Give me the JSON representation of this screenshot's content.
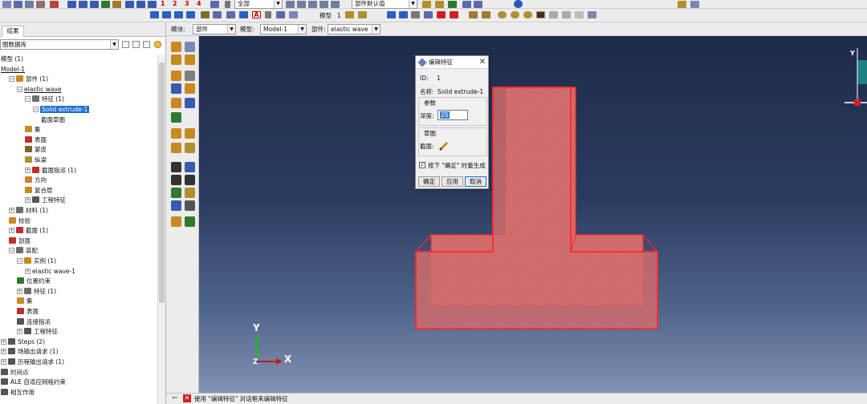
{
  "toolbar": {
    "numbers": [
      "1",
      "2",
      "3",
      "4"
    ],
    "render_style_value": "全部",
    "part_default_value": "部件默认值",
    "row2_label": "模型",
    "row2_value": "1"
  },
  "context_bar": {
    "module_label": "模块:",
    "module_value": "部件",
    "model_label": "模型:",
    "model_value": "Model-1",
    "part_label": "部件:",
    "part_value": "elastic wave"
  },
  "left_panel": {
    "tab_label": "结果",
    "db_value": "图数据库"
  },
  "tree": [
    {
      "label": "模型 (1)",
      "indent": 0,
      "expander": "",
      "icon": "",
      "selected": false,
      "underline": false
    },
    {
      "label": "Model-1",
      "indent": 0,
      "expander": "",
      "icon": "",
      "selected": false,
      "underline": true
    },
    {
      "label": "部件 (1)",
      "indent": 1,
      "expander": "−",
      "icon": "parts-icon",
      "selected": false,
      "underline": false
    },
    {
      "label": "elastic wave",
      "indent": 2,
      "expander": "−",
      "icon": "",
      "selected": false,
      "underline": true
    },
    {
      "label": "特征 (1)",
      "indent": 3,
      "expander": "−",
      "icon": "features-icon",
      "selected": false,
      "underline": false
    },
    {
      "label": "Solid extrude-1",
      "indent": 4,
      "expander": "−",
      "icon": "",
      "selected": true,
      "underline": false
    },
    {
      "label": "截面草图",
      "indent": 5,
      "expander": "",
      "icon": "",
      "selected": false,
      "underline": false
    },
    {
      "label": "集",
      "indent": 3,
      "expander": "",
      "icon": "sets-icon",
      "selected": false,
      "underline": false
    },
    {
      "label": "表面",
      "indent": 3,
      "expander": "",
      "icon": "surfaces-icon",
      "selected": false,
      "underline": false
    },
    {
      "label": "蒙皮",
      "indent": 3,
      "expander": "",
      "icon": "skins-icon",
      "selected": false,
      "underline": false
    },
    {
      "label": "纵梁",
      "indent": 3,
      "expander": "",
      "icon": "stringers-icon",
      "selected": false,
      "underline": false
    },
    {
      "label": "截面指派 (1)",
      "indent": 3,
      "expander": "+",
      "icon": "section-assignments-icon",
      "selected": false,
      "underline": false
    },
    {
      "label": "方向",
      "indent": 3,
      "expander": "",
      "icon": "orientations-icon",
      "selected": false,
      "underline": false
    },
    {
      "label": "复合层",
      "indent": 3,
      "expander": "",
      "icon": "composite-layups-icon",
      "selected": false,
      "underline": false
    },
    {
      "label": "工程特征",
      "indent": 3,
      "expander": "+",
      "icon": "engineering-features-icon",
      "selected": false,
      "underline": false
    },
    {
      "label": "材料 (1)",
      "indent": 1,
      "expander": "+",
      "icon": "materials-icon",
      "selected": false,
      "underline": false
    },
    {
      "label": "校验",
      "indent": 1,
      "expander": "",
      "icon": "calibrations-icon",
      "selected": false,
      "underline": false
    },
    {
      "label": "截面 (1)",
      "indent": 1,
      "expander": "+",
      "icon": "sections-icon",
      "selected": false,
      "underline": false
    },
    {
      "label": "剖面",
      "indent": 1,
      "expander": "",
      "icon": "profiles-icon",
      "selected": false,
      "underline": false
    },
    {
      "label": "装配",
      "indent": 1,
      "expander": "−",
      "icon": "assembly-icon",
      "selected": false,
      "underline": false
    },
    {
      "label": "实例 (1)",
      "indent": 2,
      "expander": "−",
      "icon": "instances-icon",
      "selected": false,
      "underline": false
    },
    {
      "label": "elastic wave-1",
      "indent": 3,
      "expander": "+",
      "icon": "",
      "selected": false,
      "underline": false
    },
    {
      "label": "位置约束",
      "indent": 2,
      "expander": "",
      "icon": "position-constraints-icon",
      "selected": false,
      "underline": false
    },
    {
      "label": "特征 (1)",
      "indent": 2,
      "expander": "+",
      "icon": "features-icon",
      "selected": false,
      "underline": false
    },
    {
      "label": "集",
      "indent": 2,
      "expander": "",
      "icon": "sets-icon",
      "selected": false,
      "underline": false
    },
    {
      "label": "表面",
      "indent": 2,
      "expander": "",
      "icon": "surfaces-icon",
      "selected": false,
      "underline": false
    },
    {
      "label": "连接指派",
      "indent": 2,
      "expander": "",
      "icon": "connector-assignments-icon",
      "selected": false,
      "underline": false
    },
    {
      "label": "工程特征",
      "indent": 2,
      "expander": "+",
      "icon": "engineering-features-icon",
      "selected": false,
      "underline": false
    },
    {
      "label": "Steps (2)",
      "indent": 0,
      "expander": "+",
      "icon": "steps-icon",
      "selected": false,
      "underline": false
    },
    {
      "label": "场输出请求 (1)",
      "indent": 0,
      "expander": "+",
      "icon": "field-output-icon",
      "selected": false,
      "underline": false
    },
    {
      "label": "历程输出请求 (1)",
      "indent": 0,
      "expander": "+",
      "icon": "history-output-icon",
      "selected": false,
      "underline": false
    },
    {
      "label": "时间点",
      "indent": 0,
      "expander": "",
      "icon": "time-points-icon",
      "selected": false,
      "underline": false
    },
    {
      "label": "ALE 自适应网格约束",
      "indent": 0,
      "expander": "",
      "icon": "ale-constraints-icon",
      "selected": false,
      "underline": false
    },
    {
      "label": "相互作用",
      "indent": 0,
      "expander": "",
      "icon": "interactions-icon",
      "selected": false,
      "underline": false
    }
  ],
  "dialog": {
    "title": "编辑特征",
    "id_label": "ID:",
    "id_value": "1",
    "name_label": "名称:",
    "name_value": "Solid extrude-1",
    "params_group": "参数",
    "depth_label": "深度:",
    "depth_value": "25",
    "sketch_group": "草图",
    "section_label": "截面:",
    "regen_label": "按下 \"确定\" 时重生成",
    "regen_checked": true,
    "ok_label": "确定",
    "apply_label": "应用",
    "cancel_label": "取消"
  },
  "viewport": {
    "axis_y": "Y",
    "axis_x": "X",
    "axis_z": "Z",
    "model_color": "#e62020",
    "fill_color": "#c65a5a"
  },
  "status": {
    "message": "使用 \"编辑特征\" 对话框来编辑特征"
  },
  "colors": {
    "selection": "#1e6fd0",
    "viewport_top": "#1e2b4b",
    "viewport_bottom": "#8192b2"
  }
}
